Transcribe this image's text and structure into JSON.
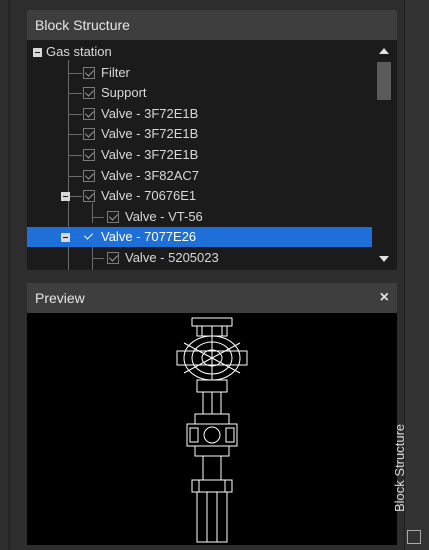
{
  "block_structure": {
    "title": "Block Structure",
    "tree": [
      {
        "label": "Gas station",
        "level": 0,
        "toggle": true,
        "checkbox": false
      },
      {
        "label": "Filter",
        "level": 1,
        "checkbox": true
      },
      {
        "label": "Support",
        "level": 1,
        "checkbox": true
      },
      {
        "label": "Valve - 3F72E1B",
        "level": 1,
        "checkbox": true
      },
      {
        "label": "Valve - 3F72E1B",
        "level": 1,
        "checkbox": true
      },
      {
        "label": "Valve - 3F72E1B",
        "level": 1,
        "checkbox": true
      },
      {
        "label": "Valve - 3F82AC7",
        "level": 1,
        "checkbox": true
      },
      {
        "label": "Valve - 70676E1",
        "level": 1,
        "toggle": true,
        "checkbox": true
      },
      {
        "label": "Valve - VT-56",
        "level": 2,
        "checkbox": true
      },
      {
        "label": "Valve - 7077E26",
        "level": 1,
        "toggle": true,
        "checkbox": true,
        "selected": true
      },
      {
        "label": "Valve - 5205023",
        "level": 2,
        "checkbox": true
      }
    ]
  },
  "preview": {
    "title": "Preview",
    "close_label": "×"
  },
  "side_tab": {
    "label": "Block Structure"
  },
  "colors": {
    "selection": "#1f6fd8",
    "panel_bg": "#2d2d2d",
    "tree_bg": "#1b1b1b",
    "preview_bg": "#000000",
    "drawing_stroke": "#ffffff"
  }
}
